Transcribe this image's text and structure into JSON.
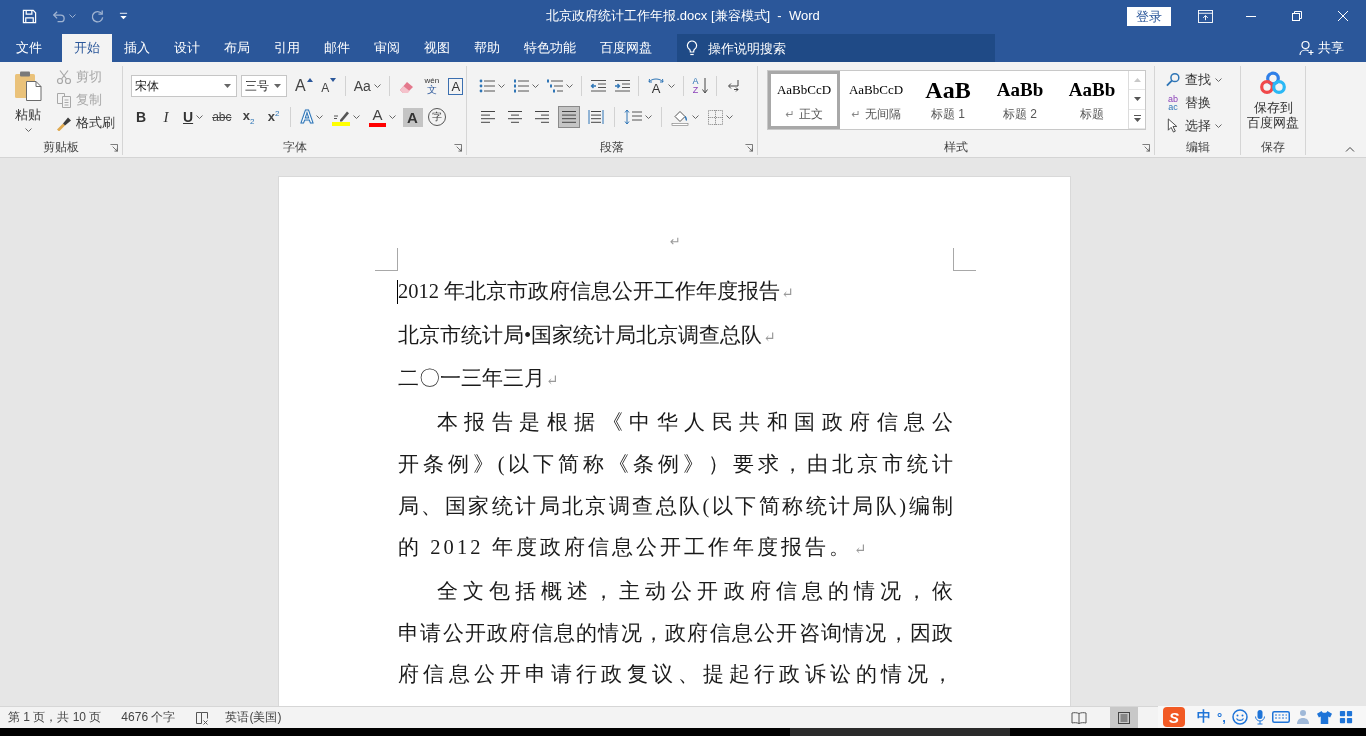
{
  "window": {
    "title": "北京政府统计工作年报.docx [兼容模式]  -  Word",
    "sign_in": "登录"
  },
  "quick_access": [
    {
      "kind": "save",
      "disabled": false
    },
    {
      "kind": "undo",
      "disabled": true
    },
    {
      "kind": "redo",
      "disabled": true
    },
    {
      "kind": "customize",
      "disabled": false
    }
  ],
  "tabs": [
    {
      "label": "文件",
      "selected": false
    },
    {
      "label": "开始",
      "selected": true
    },
    {
      "label": "插入",
      "selected": false
    },
    {
      "label": "设计",
      "selected": false
    },
    {
      "label": "布局",
      "selected": false
    },
    {
      "label": "引用",
      "selected": false
    },
    {
      "label": "邮件",
      "selected": false
    },
    {
      "label": "审阅",
      "selected": false
    },
    {
      "label": "视图",
      "selected": false
    },
    {
      "label": "帮助",
      "selected": false
    },
    {
      "label": "特色功能",
      "selected": false
    },
    {
      "label": "百度网盘",
      "selected": false
    }
  ],
  "tell_me": {
    "placeholder": "操作说明搜索"
  },
  "share": {
    "label": "共享"
  },
  "ribbon": {
    "clipboard": {
      "label": "剪贴板",
      "paste": "粘贴",
      "items": [
        {
          "kind": "cut",
          "label": "剪切",
          "disabled": true
        },
        {
          "kind": "copy",
          "label": "复制",
          "disabled": true
        },
        {
          "kind": "format_painter",
          "label": "格式刷",
          "disabled": false
        }
      ]
    },
    "font": {
      "label": "字体",
      "font_name": "宋体",
      "font_size": "三号",
      "grow": "A",
      "shrink": "A",
      "change_case": "Aa",
      "pinyin_top": "wén",
      "pinyin_bottom": "文",
      "border_char": "A",
      "bold": "B",
      "italic": "I",
      "underline": "U",
      "strikethrough": "abc",
      "subscript": "x$_{2}$",
      "superscript": "x$^{2}$",
      "effects": "A",
      "font_color_char": "A",
      "shading_char": "A",
      "enclose_char": "字"
    },
    "paragraph": {
      "label": "段落",
      "asian_layout": "A",
      "sort_top": "A",
      "sort_bottom": "Z",
      "alignments": [
        {
          "kind": "left",
          "selected": false
        },
        {
          "kind": "center",
          "selected": false
        },
        {
          "kind": "right",
          "selected": false
        },
        {
          "kind": "justify",
          "selected": true
        },
        {
          "kind": "distributed",
          "selected": false
        }
      ]
    },
    "styles": {
      "label": "样式",
      "items": [
        {
          "kind": "normal",
          "preview": "AaBbCcD",
          "mark": "↵",
          "name": "正文",
          "selected": true
        },
        {
          "kind": "normal",
          "preview": "AaBbCcD",
          "mark": "↵",
          "name": "无间隔",
          "selected": false
        },
        {
          "kind": "heading1",
          "preview": "AaB",
          "name": "标题 1",
          "selected": false
        },
        {
          "kind": "heading2",
          "preview": "AaBb",
          "name": "标题 2",
          "selected": false
        },
        {
          "kind": "title",
          "preview": "AaBb",
          "name": "标题",
          "selected": false
        }
      ],
      "scroll_buttons": [
        {
          "kind": "up",
          "disabled": true
        },
        {
          "kind": "down",
          "disabled": false
        },
        {
          "kind": "more",
          "disabled": false
        }
      ]
    },
    "editing": {
      "label": "编辑",
      "items": [
        {
          "kind": "find",
          "label": "查找"
        },
        {
          "kind": "replace",
          "label": "替换",
          "glyph_top": "ab",
          "glyph_bottom": "ac"
        },
        {
          "kind": "select",
          "label": "选择"
        }
      ]
    },
    "save": {
      "label": "保存",
      "button_lines": [
        "保存到",
        "百度网盘"
      ]
    }
  },
  "document": {
    "header_mark": "↵",
    "paragraphs": [
      {
        "kind": "plain",
        "cursor": true,
        "lines": [
          "2012 年北京市政府信息公开工作年度报告"
        ],
        "mark": "↵"
      },
      {
        "kind": "plain",
        "cursor": false,
        "lines": [
          "北京市统计局•国家统计局北京调查总队"
        ],
        "mark": "↵"
      },
      {
        "kind": "plain",
        "cursor": false,
        "lines": [
          "二〇一三年三月"
        ],
        "mark": "↵"
      },
      {
        "kind": "body",
        "cursor": false,
        "lines": [
          "本报告是根据《中华人民共和国政府信息公",
          "开条例》(以下简称《条例》）要求，由北京市统计",
          "局、国家统计局北京调查总队(以下简称统计局队)编制",
          "的 2012 年度政府信息公开工作年度报告。"
        ],
        "mark": "↵"
      },
      {
        "kind": "body",
        "cursor": false,
        "lines": [
          "全文包括概述，主动公开政府信息的情况，依",
          "申请公开政府信息的情况，政府信息公开咨询情况，因政",
          "府信息公开申请行政复议、提起行政诉讼的情况，"
        ]
      }
    ]
  },
  "status_bar": {
    "page": "第 1 页，共 10 页",
    "words": "4676 个字",
    "language": "英语(美国)",
    "views": [
      {
        "kind": "read",
        "selected": false
      },
      {
        "kind": "print",
        "selected": true
      }
    ]
  },
  "ime": {
    "logo": "S",
    "mode": "中",
    "punctuation": "°,"
  }
}
